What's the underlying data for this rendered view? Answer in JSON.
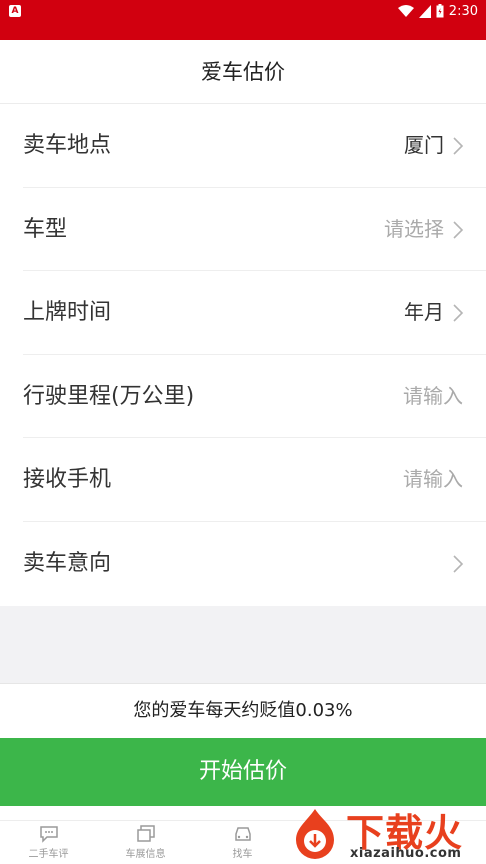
{
  "statusbar": {
    "app_badge": "A",
    "time": "2:30"
  },
  "appbar": {
    "title": "爱车估价"
  },
  "form": {
    "rows": [
      {
        "label": "卖车地点",
        "value": "厦门"
      },
      {
        "label": "车型",
        "value": "请选择"
      },
      {
        "label": "上牌时间",
        "value": "年月"
      },
      {
        "label": "行驶里程(万公里)",
        "value": "请输入"
      },
      {
        "label": "接收手机",
        "value": "请输入"
      },
      {
        "label": "卖车意向",
        "value": ""
      }
    ]
  },
  "hint": "您的爱车每天约贬值0.03%",
  "cta_label": "开始估价",
  "tabs": [
    {
      "label": "二手车评",
      "icon": "chat-icon"
    },
    {
      "label": "车展信息",
      "icon": "exhibit-icon"
    },
    {
      "label": "找车",
      "icon": "car-icon"
    }
  ],
  "watermark": {
    "brand": "下载火",
    "domain": "xiazaihuo.com"
  },
  "colors": {
    "status_bar": "#d1000f",
    "cta": "#3cb64a",
    "watermark": "#e8401e"
  }
}
